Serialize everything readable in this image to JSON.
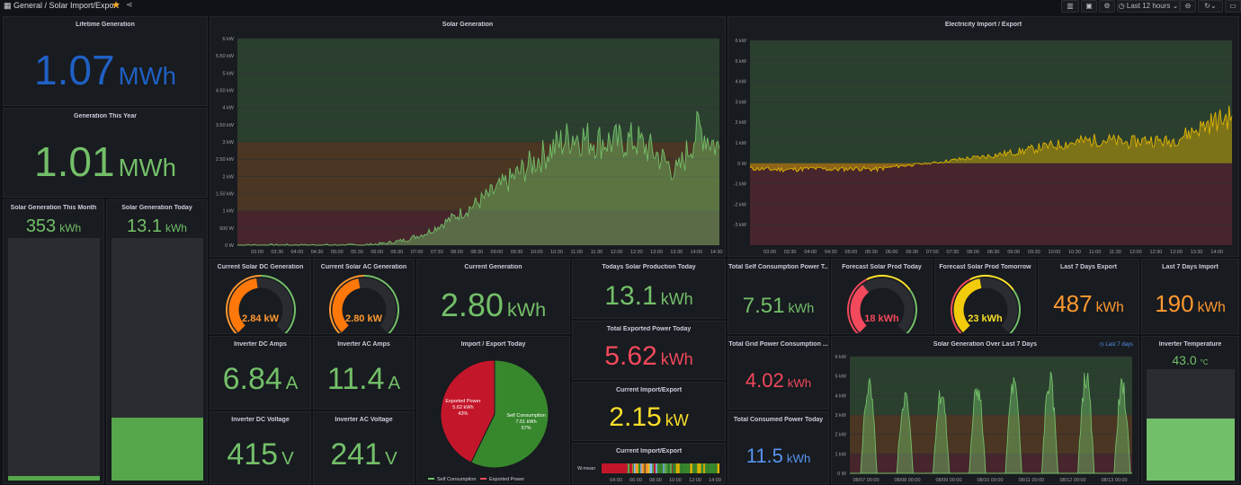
{
  "header": {
    "breadcrumb": "General / Solar Import/Export",
    "time_range": "Last 12 hours"
  },
  "colors": {
    "green": "#73bf69",
    "red": "#f2495c",
    "orange": "#ff9830",
    "yellow": "#fade2a",
    "blue": "#5794f2",
    "darkblue": "#1f60c4"
  },
  "panels": {
    "lifetime": {
      "title": "Lifetime Generation",
      "value": "1.07",
      "unit": "MWh"
    },
    "year": {
      "title": "Generation This Year",
      "value": "1.01",
      "unit": "MWh"
    },
    "month": {
      "title": "Solar Generation This Month",
      "value": "353",
      "unit": "kWh",
      "fill": 0.02
    },
    "today": {
      "title": "Solar Generation Today",
      "value": "13.1",
      "unit": "kWh",
      "fill": 0.26
    },
    "solar_gen": {
      "title": "Solar Generation"
    },
    "elec": {
      "title": "Electricity Import / Export"
    },
    "dc_gen": {
      "title": "Current Solar DC Generation",
      "value": "2.84 kW",
      "fraction": 0.47
    },
    "ac_gen": {
      "title": "Current Solar AC Generation",
      "value": "2.80 kW",
      "fraction": 0.46
    },
    "current_gen": {
      "title": "Current Generation",
      "value": "2.80",
      "unit": "kWh"
    },
    "todays_prod": {
      "title": "Todays Solar Production Today",
      "value": "13.1",
      "unit": "kWh"
    },
    "self_cons": {
      "title": "Total Self Consumption Power T...",
      "value": "7.51",
      "unit": "kWh"
    },
    "forecast_today": {
      "title": "Forecast Solar Prod Today",
      "value": "18 kWh",
      "fraction": 0.36
    },
    "forecast_tomorrow": {
      "title": "Forecast Solar Prod Tomorrow",
      "value": "23 kWh",
      "fraction": 0.46
    },
    "export7": {
      "title": "Last 7 Days Export",
      "value": "487",
      "unit": "kWh"
    },
    "import7": {
      "title": "Last 7 Days Import",
      "value": "190",
      "unit": "kWh"
    },
    "dc_amps": {
      "title": "Inverter DC Amps",
      "value": "6.84",
      "unit": "A"
    },
    "ac_amps": {
      "title": "Inverter AC Amps",
      "value": "11.4",
      "unit": "A"
    },
    "dc_volt": {
      "title": "Inverter DC Voltage",
      "value": "415",
      "unit": "V"
    },
    "ac_volt": {
      "title": "Inverter AC Voltage",
      "value": "241",
      "unit": "V"
    },
    "ie_today": {
      "title": "Import / Export Today"
    },
    "exported": {
      "title": "Total Exported Power Today",
      "value": "5.62",
      "unit": "kWh"
    },
    "cur_ie": {
      "title": "Current Import/Export",
      "value": "2.15",
      "unit": "kW"
    },
    "cur_ie2": {
      "title": "Current Import/Export",
      "row_label": "W.mean"
    },
    "grid_cons": {
      "title": "Total Grid Power Consumption ...",
      "value": "4.02",
      "unit": "kWh"
    },
    "consumed": {
      "title": "Total Consumed Power Today",
      "value": "11.5",
      "unit": "kWh"
    },
    "gen7": {
      "title": "Solar Generation Over Last 7 Days",
      "badge": "Last 7 days"
    },
    "temp": {
      "title": "Inverter Temperature",
      "value": "43.0",
      "unit": "°C",
      "fill": 0.56
    }
  },
  "chart_data": [
    {
      "type": "area",
      "title": "Solar Generation",
      "x": [
        "03:00",
        "03:30",
        "04:00",
        "04:30",
        "05:00",
        "05:30",
        "06:00",
        "06:30",
        "07:00",
        "07:30",
        "08:00",
        "08:30",
        "09:00",
        "09:30",
        "10:00",
        "10:30",
        "11:00",
        "11:30",
        "12:00",
        "12:30",
        "13:00",
        "13:30",
        "14:00",
        "14:30"
      ],
      "series": [
        {
          "values": [
            0,
            0,
            0,
            0,
            0,
            0,
            0,
            0.05,
            0.15,
            0.35,
            0.7,
            1.05,
            1.45,
            1.9,
            2.35,
            2.8,
            3.2,
            3.05,
            3.0,
            3.05,
            2.65,
            2.1,
            3.4,
            2.8
          ]
        }
      ],
      "yticks": [
        "0 W",
        "500 W",
        "1 kW",
        "1.50 kW",
        "2 kW",
        "2.50 kW",
        "3 kW",
        "3.50 kW",
        "4 kW",
        "4.50 kW",
        "5 kW",
        "5.50 kW",
        "6 kW"
      ],
      "ylim": [
        0,
        6
      ]
    },
    {
      "type": "area",
      "title": "Electricity Import / Export",
      "x": [
        "03:00",
        "03:30",
        "04:00",
        "04:30",
        "05:00",
        "05:30",
        "06:00",
        "06:30",
        "07:00",
        "07:30",
        "08:00",
        "08:30",
        "09:00",
        "09:30",
        "10:00",
        "10:30",
        "11:00",
        "11:30",
        "12:00",
        "12:30",
        "13:00",
        "13:30",
        "14:00",
        "14:30"
      ],
      "series": [
        {
          "values": [
            -0.25,
            -0.3,
            -0.3,
            -0.25,
            -0.3,
            -0.25,
            -0.3,
            -0.15,
            -0.05,
            0.05,
            0.2,
            0.3,
            0.45,
            0.6,
            0.8,
            0.95,
            1.1,
            1.15,
            1.0,
            1.15,
            1.05,
            1.5,
            2.0,
            2.3
          ]
        }
      ],
      "yticks": [
        "-3 kW",
        "-2 kW",
        "-1 kW",
        "0 W",
        "1 kW",
        "2 kW",
        "3 kW",
        "4 kW",
        "5 kW",
        "6 kW"
      ],
      "ylim": [
        -4,
        6
      ]
    },
    {
      "type": "pie",
      "title": "Import / Export Today",
      "series": [
        {
          "name": "Self Consumption",
          "value": 7.51,
          "label": "Self Consumption",
          "sub": "7.51 kWh",
          "pct": "57%"
        },
        {
          "name": "Exported Power",
          "value": 5.62,
          "label": "Exported Power",
          "sub": "5.62 kWh",
          "pct": "43%"
        }
      ]
    },
    {
      "type": "heatmap",
      "title": "Current Import/Export",
      "x": [
        "04:00",
        "06:00",
        "08:00",
        "10:00",
        "12:00",
        "14:00"
      ]
    },
    {
      "type": "area",
      "title": "Solar Generation Over Last 7 Days",
      "x": [
        "08/07 00:00",
        "08/08 00:00",
        "08/09 00:00",
        "08/10 00:00",
        "08/11 00:00",
        "08/12 00:00",
        "08/13 00:00"
      ],
      "series": [
        {
          "values": [
            5.1,
            4.5,
            4.7,
            5.0,
            5.2,
            5.4,
            5.6,
            5.0
          ]
        }
      ],
      "yticks": [
        "0 W",
        "1 kW",
        "2 kW",
        "3 kW",
        "4 kW",
        "5 kW",
        "6 kW"
      ],
      "ylim": [
        0,
        6
      ]
    }
  ]
}
